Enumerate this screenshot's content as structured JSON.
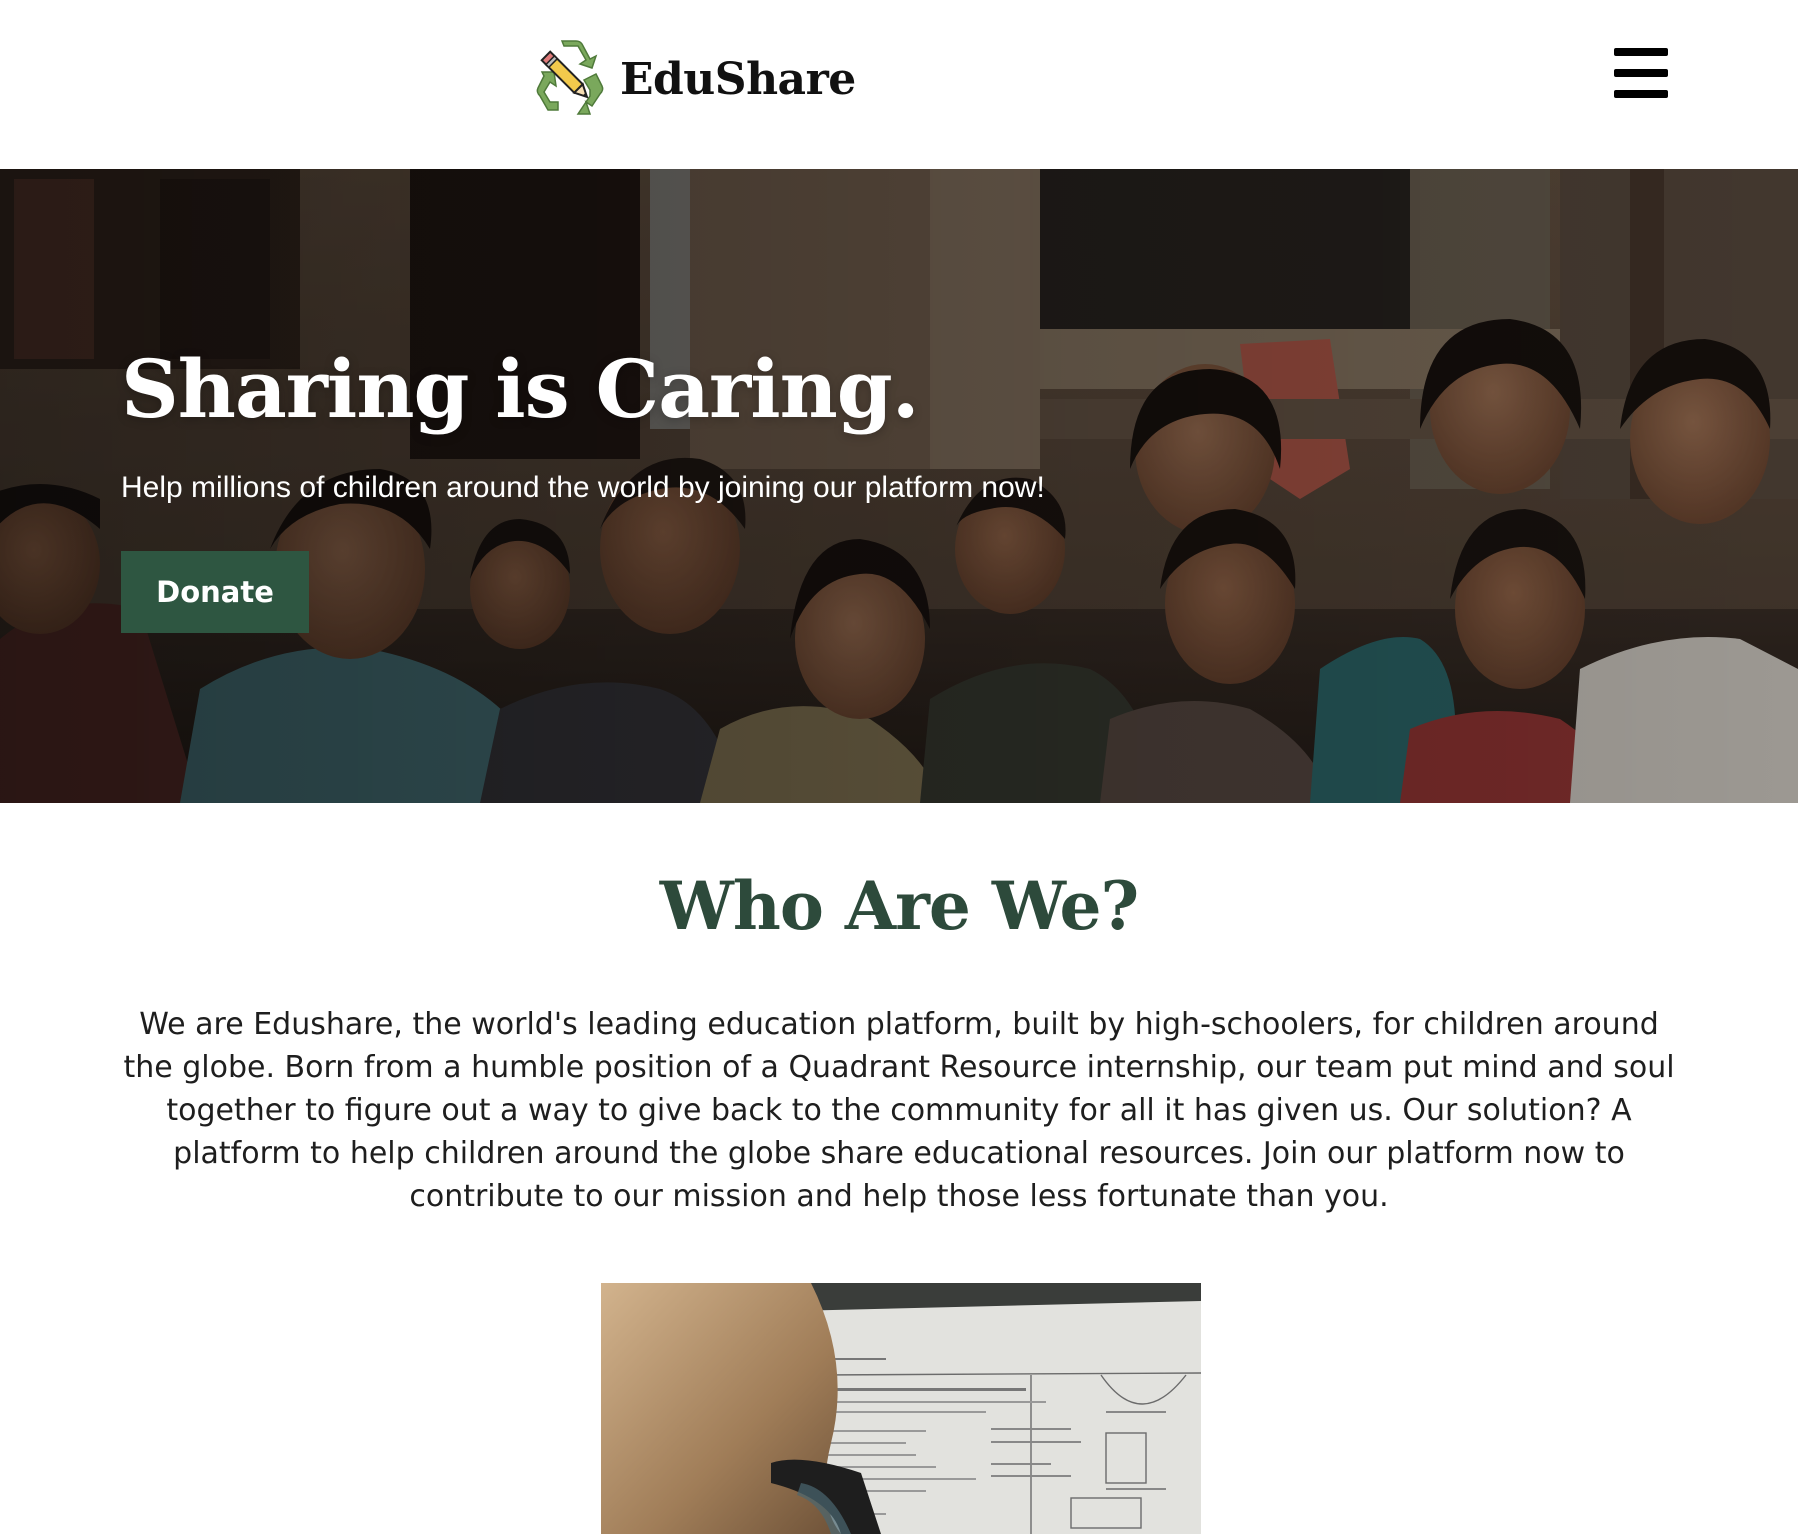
{
  "header": {
    "brand_name": "EduShare",
    "logo_icon": "recycle-pencil-icon",
    "menu_icon": "hamburger-menu-icon"
  },
  "hero": {
    "title": "Sharing is Caring.",
    "subtitle": "Help millions of children around the world by joining our platform now!",
    "donate_label": "Donate"
  },
  "about": {
    "heading": "Who Are We?",
    "paragraph": "We are Edushare, the world's leading education platform, built by high-schoolers, for children around the globe. Born from a humble position of a Quadrant Resource internship, our team put mind and soul together to figure out a way to give back to the community for all it has given us. Our solution? A platform to help children around the globe share educational resources. Join our platform now to contribute to our mission and help those less fortunate than you."
  },
  "colors": {
    "accent_green": "#2e5641",
    "heading_green": "#2d4a3b",
    "text": "#1e1e1e",
    "background": "#ffffff"
  }
}
